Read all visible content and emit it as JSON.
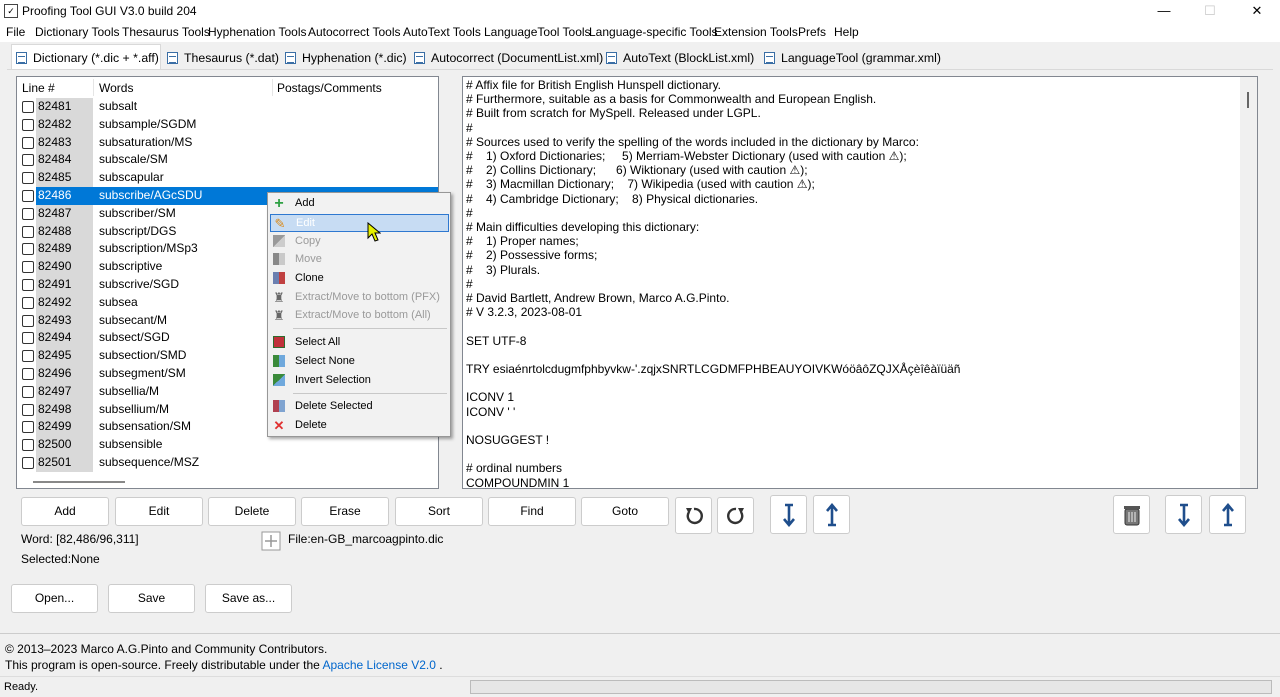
{
  "window": {
    "title": "Proofing Tool GUI V3.0 build 204",
    "minimize": "—",
    "maximize": "☐",
    "close": "✕"
  },
  "menu": [
    "File",
    "Dictionary Tools",
    "Thesaurus Tools",
    "Hyphenation Tools",
    "Autocorrect Tools",
    "AutoText Tools",
    "LanguageTool Tools",
    "Language-specific Tools",
    "Extension Tools",
    "Prefs",
    "Help"
  ],
  "tabs": [
    "Dictionary (*.dic + *.aff)",
    "Thesaurus (*.dat)",
    "Hyphenation (*.dic)",
    "Autocorrect (DocumentList.xml)",
    "AutoText (BlockList.xml)",
    "LanguageTool (grammar.xml)"
  ],
  "list": {
    "headers": {
      "line": "Line #",
      "words": "Words",
      "postags": "Postags/Comments"
    },
    "rows": [
      {
        "line": "82481",
        "word": "subsalt"
      },
      {
        "line": "82482",
        "word": "subsample/SGDM"
      },
      {
        "line": "82483",
        "word": "subsaturation/MS"
      },
      {
        "line": "82484",
        "word": "subscale/SM"
      },
      {
        "line": "82485",
        "word": "subscapular"
      },
      {
        "line": "82486",
        "word": "subscribe/AGcSDU"
      },
      {
        "line": "82487",
        "word": "subscriber/SM"
      },
      {
        "line": "82488",
        "word": "subscript/DGS"
      },
      {
        "line": "82489",
        "word": "subscription/MSp3"
      },
      {
        "line": "82490",
        "word": "subscriptive"
      },
      {
        "line": "82491",
        "word": "subscrive/SGD"
      },
      {
        "line": "82492",
        "word": "subsea"
      },
      {
        "line": "82493",
        "word": "subsecant/M"
      },
      {
        "line": "82494",
        "word": "subsect/SGD"
      },
      {
        "line": "82495",
        "word": "subsection/SMD"
      },
      {
        "line": "82496",
        "word": "subsegment/SM"
      },
      {
        "line": "82497",
        "word": "subsellia/M"
      },
      {
        "line": "82498",
        "word": "subsellium/M"
      },
      {
        "line": "82499",
        "word": "subsensation/SM"
      },
      {
        "line": "82500",
        "word": "subsensible"
      },
      {
        "line": "82501",
        "word": "subsequence/MSZ"
      }
    ],
    "selected_line": "82486"
  },
  "context_menu": {
    "items": [
      {
        "label": "Add",
        "icon": "plus-icon"
      },
      {
        "label": "Edit",
        "icon": "pencil-icon"
      },
      {
        "label": "Copy",
        "icon": "copy-icon"
      },
      {
        "label": "Move",
        "icon": "move-icon"
      },
      {
        "label": "Clone",
        "icon": "clone-icon"
      },
      {
        "label": "Extract/Move to bottom (PFX)",
        "icon": "extract-icon"
      },
      {
        "label": "Extract/Move to bottom (All)",
        "icon": "extract-icon"
      },
      {
        "label": "Select All",
        "icon": "select-all-icon"
      },
      {
        "label": "Select None",
        "icon": "select-none-icon"
      },
      {
        "label": "Invert Selection",
        "icon": "invert-selection-icon"
      },
      {
        "label": "Delete Selected",
        "icon": "delete-selected-icon"
      },
      {
        "label": "Delete",
        "icon": "delete-icon"
      }
    ],
    "hovered": "Edit",
    "disabled": [
      "Copy",
      "Move",
      "Extract/Move to bottom (PFX)",
      "Extract/Move to bottom (All)"
    ]
  },
  "affix_text": [
    "# Affix file for British English Hunspell dictionary.",
    "# Furthermore, suitable as a basis for Commonwealth and European English.",
    "# Built from scratch for MySpell. Released under LGPL.",
    "#",
    "# Sources used to verify the spelling of the words included in the dictionary by Marco:",
    "#    1) Oxford Dictionaries;     5) Merriam-Webster Dictionary (used with caution ⚠);",
    "#    2) Collins Dictionary;      6) Wiktionary (used with caution ⚠);",
    "#    3) Macmillan Dictionary;    7) Wikipedia (used with caution ⚠);",
    "#    4) Cambridge Dictionary;    8) Physical dictionaries.",
    "#",
    "# Main difficulties developing this dictionary:",
    "#    1) Proper names;",
    "#    2) Possessive forms;",
    "#    3) Plurals.",
    "#",
    "# David Bartlett, Andrew Brown, Marco A.G.Pinto.",
    "# V 3.2.3, 2023-08-01",
    "",
    "SET UTF-8",
    "",
    "TRY esiaénrtolcdugmfphbyvkw-'.zqjxSNRTLCGDMFPHBEAUYOIVKWóöâôZQJXÅçèîêàïüäñ",
    "",
    "ICONV 1",
    "ICONV ' '",
    "",
    "NOSUGGEST !",
    "",
    "# ordinal numbers",
    "COMPOUNDMIN 1"
  ],
  "buttons": {
    "add": "Add",
    "edit": "Edit",
    "delete": "Delete",
    "erase": "Erase",
    "sort": "Sort",
    "find": "Find",
    "goto": "Goto",
    "open": "Open...",
    "save": "Save",
    "save_as": "Save as..."
  },
  "info": {
    "word": "Word: [82,486/96,311]",
    "selected": "Selected:None",
    "file": "File:en-GB_marcoagpinto.dic"
  },
  "footer": {
    "copyright": "© 2013–2023 Marco A.G.Pinto and Community Contributors.",
    "license_prefix": "This program is open-source. Freely distributable under the",
    "license_link": "Apache License V2.0",
    "license_suffix": "."
  },
  "status": "Ready."
}
